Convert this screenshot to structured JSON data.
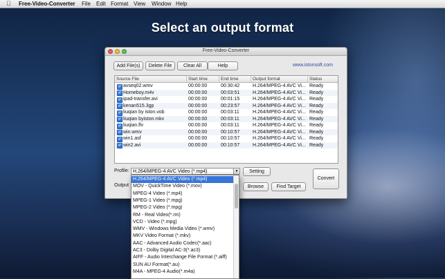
{
  "menubar": {
    "app_name": "Free-Video-Converter",
    "items": [
      "File",
      "Edit",
      "Format",
      "View",
      "Window",
      "Help"
    ]
  },
  "headline": "Select an output format",
  "window": {
    "title": "Free-Video-Converter",
    "website": "www.istonsoft.com",
    "toolbar": {
      "add_files": "Add File(s)",
      "delete_file": "Delete File",
      "clear_all": "Clear All",
      "help": "Help"
    },
    "table": {
      "columns": [
        "Source File",
        "Start time",
        "End time",
        "Output format",
        "Status"
      ],
      "rows": [
        {
          "file": "avseq02.wmv",
          "start": "00:00:00",
          "end": "00:30:42",
          "format": "H.264/MPEG-4 AVC Vi...",
          "status": "Ready"
        },
        {
          "file": "Homeboy.m4v",
          "start": "00:00:00",
          "end": "00:03:51",
          "format": "H.264/MPEG-4 AVC Vi...",
          "status": "Ready"
        },
        {
          "file": "ipad-transfer.avi",
          "start": "00:00:00",
          "end": "00:01:15",
          "format": "H.264/MPEG-4 AVC Vi...",
          "status": "Ready"
        },
        {
          "file": "kenan515.3gp",
          "start": "00:00:00",
          "end": "00:23:57",
          "format": "H.264/MPEG-4 AVC Vi...",
          "status": "Ready"
        },
        {
          "file": "liuqian by iston.vob",
          "start": "00:00:00",
          "end": "00:03:11",
          "format": "H.264/MPEG-4 AVC Vi...",
          "status": "Ready"
        },
        {
          "file": "liuqian byiston.mkv",
          "start": "00:00:00",
          "end": "00:03:11",
          "format": "H.264/MPEG-4 AVC Vi...",
          "status": "Ready"
        },
        {
          "file": "liuqian.flv",
          "start": "00:00:00",
          "end": "00:03:11",
          "format": "H.264/MPEG-4 AVC Vi...",
          "status": "Ready"
        },
        {
          "file": "win.wmv",
          "start": "00:00:00",
          "end": "00:10:57",
          "format": "H.264/MPEG-4 AVC Vi...",
          "status": "Ready"
        },
        {
          "file": "win1.asf",
          "start": "00:00:00",
          "end": "00:10:57",
          "format": "H.264/MPEG-4 AVC Vi...",
          "status": "Ready"
        },
        {
          "file": "win2.avi",
          "start": "00:00:00",
          "end": "00:10:57",
          "format": "H.264/MPEG-4 AVC Vi...",
          "status": "Ready"
        }
      ]
    },
    "profile_label": "Profile:",
    "profile_value": "H.264/MPEG-4 AVC Video (*.mp4)",
    "output_label": "Output",
    "setting_button": "Setting",
    "browse_button": "Browse",
    "find_target_button": "Find Target",
    "convert_button": "Convert"
  },
  "dropdown": {
    "options": [
      "H.264/MPEG-4 AVC Video (*.mp4)",
      "MOV - QuickTime Video (*.mov)",
      "MPEG-4 Video (*.mp4)",
      "MPEG-1 Video (*.mpg)",
      "MPEG-2 Video (*.mpg)",
      "RM - Real Video(*.rm)",
      "VCD - Video (*.mpg)",
      "WMV - Windows Media Video (*.wmv)",
      "MKV Video Format (*.mkv)",
      "AAC - Advanced Audio Codec(*.aac)",
      "AC3 - Dolby Digital AC-3(*.ac3)",
      "AIFF - Audio Interchange File Format (*.aiff)",
      "SUN AU Format(*.au)",
      "M4A - MPEG-4 Audio(*.m4a)"
    ],
    "selected_index": 0
  },
  "colors": {
    "selection": "#3875d7",
    "link": "#2e4da0"
  }
}
